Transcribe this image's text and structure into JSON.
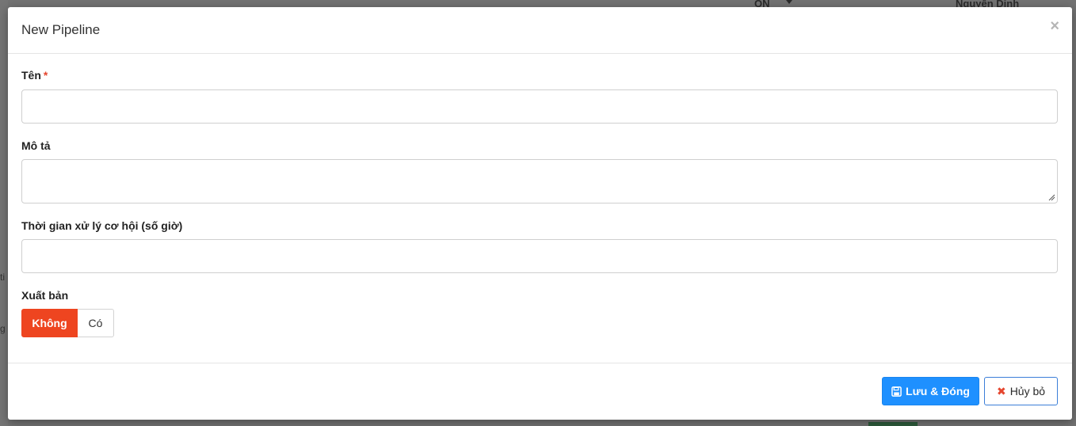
{
  "background": {
    "lang_label": "ON",
    "user_name": "Nguyễn Dinh",
    "left_fragments": [
      "ti",
      "g"
    ]
  },
  "modal": {
    "title": "New Pipeline",
    "close_glyph": "×"
  },
  "form": {
    "name": {
      "label": "Tên",
      "required_mark": "*",
      "value": ""
    },
    "description": {
      "label": "Mô tả",
      "value": ""
    },
    "processing_time": {
      "label": "Thời gian xử lý cơ hội (số giờ)",
      "value": ""
    },
    "publish": {
      "label": "Xuất bản",
      "options": [
        "Không",
        "Có"
      ],
      "selected": "Không"
    }
  },
  "footer": {
    "save_label": "Lưu & Đóng",
    "cancel_label": "Hủy bỏ"
  },
  "colors": {
    "primary": "#1e90ff",
    "toggle_active": "#ee4520",
    "required": "#e5462f"
  },
  "icons": {
    "save": "floppy-disk-icon",
    "cancel": "x-icon",
    "close": "close-icon"
  }
}
